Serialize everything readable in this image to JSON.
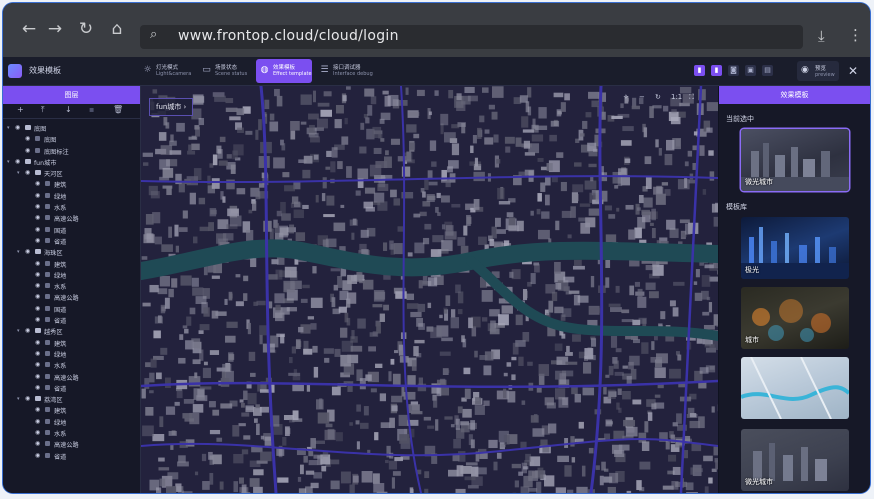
{
  "browser": {
    "url": "www.frontop.cloud/cloud/login",
    "icons": [
      "back-arrow-icon",
      "forward-arrow-icon",
      "reload-icon",
      "home-icon",
      "search-icon",
      "download-icon",
      "kebab-menu-icon"
    ]
  },
  "app": {
    "title": "效果模板",
    "tools": [
      {
        "title": "灯光模式",
        "subtitle": "Light&camera",
        "icon": "bulb-icon",
        "active": false
      },
      {
        "title": "场景状态",
        "subtitle": "Scene status",
        "icon": "scene-icon",
        "active": false
      },
      {
        "title": "效果模板",
        "subtitle": "Effect template",
        "icon": "globe-icon",
        "active": true
      },
      {
        "title": "接口调试器",
        "subtitle": "Interface debug",
        "icon": "sliders-icon",
        "active": false
      }
    ],
    "preview": {
      "title": "预览",
      "subtitle": "preview"
    },
    "accent": "#7b4ff0"
  },
  "left": {
    "header": "图层",
    "toolbar_icons": [
      "add-icon",
      "move-top-icon",
      "move-down-icon",
      "filter-icon",
      "delete-icon"
    ],
    "tree": [
      {
        "label": "底图",
        "level": 0,
        "type": "folder"
      },
      {
        "label": "底图",
        "level": 1,
        "type": "layer"
      },
      {
        "label": "底图标注",
        "level": 1,
        "type": "layer"
      },
      {
        "label": "fun城市",
        "level": 0,
        "type": "folder"
      },
      {
        "label": "天河区",
        "level": 1,
        "type": "folder"
      },
      {
        "label": "建筑",
        "level": 2,
        "type": "layer"
      },
      {
        "label": "绿地",
        "level": 2,
        "type": "layer"
      },
      {
        "label": "水系",
        "level": 2,
        "type": "layer"
      },
      {
        "label": "高速公路",
        "level": 2,
        "type": "layer"
      },
      {
        "label": "国道",
        "level": 2,
        "type": "layer"
      },
      {
        "label": "省道",
        "level": 2,
        "type": "layer"
      },
      {
        "label": "海珠区",
        "level": 1,
        "type": "folder"
      },
      {
        "label": "建筑",
        "level": 2,
        "type": "layer"
      },
      {
        "label": "绿地",
        "level": 2,
        "type": "layer"
      },
      {
        "label": "水系",
        "level": 2,
        "type": "layer"
      },
      {
        "label": "高速公路",
        "level": 2,
        "type": "layer"
      },
      {
        "label": "国道",
        "level": 2,
        "type": "layer"
      },
      {
        "label": "省道",
        "level": 2,
        "type": "layer"
      },
      {
        "label": "越秀区",
        "level": 1,
        "type": "folder"
      },
      {
        "label": "建筑",
        "level": 2,
        "type": "layer"
      },
      {
        "label": "绿地",
        "level": 2,
        "type": "layer"
      },
      {
        "label": "水系",
        "level": 2,
        "type": "layer"
      },
      {
        "label": "高速公路",
        "level": 2,
        "type": "layer"
      },
      {
        "label": "省道",
        "level": 2,
        "type": "layer"
      },
      {
        "label": "荔湾区",
        "level": 1,
        "type": "folder"
      },
      {
        "label": "建筑",
        "level": 2,
        "type": "layer"
      },
      {
        "label": "绿地",
        "level": 2,
        "type": "layer"
      },
      {
        "label": "水系",
        "level": 2,
        "type": "layer"
      },
      {
        "label": "高速公路",
        "level": 2,
        "type": "layer"
      },
      {
        "label": "省道",
        "level": 2,
        "type": "layer"
      }
    ]
  },
  "map": {
    "breadcrumb": "fun城市 ›",
    "tools": [
      "compass-icon",
      "minus-icon",
      "rotate-icon",
      "1:1",
      "fullscreen-icon"
    ]
  },
  "right": {
    "header": "效果模板",
    "current_label": "当前选中",
    "current": {
      "caption": "微光城市"
    },
    "library_label": "模板库",
    "templates": [
      {
        "caption": "极光",
        "color": "#1d3a72"
      },
      {
        "caption": "城市",
        "color": "#3b3a30"
      },
      {
        "caption": "",
        "color": "#b8c8d8"
      },
      {
        "caption": "微光城市",
        "color": "#3d4150"
      }
    ]
  }
}
